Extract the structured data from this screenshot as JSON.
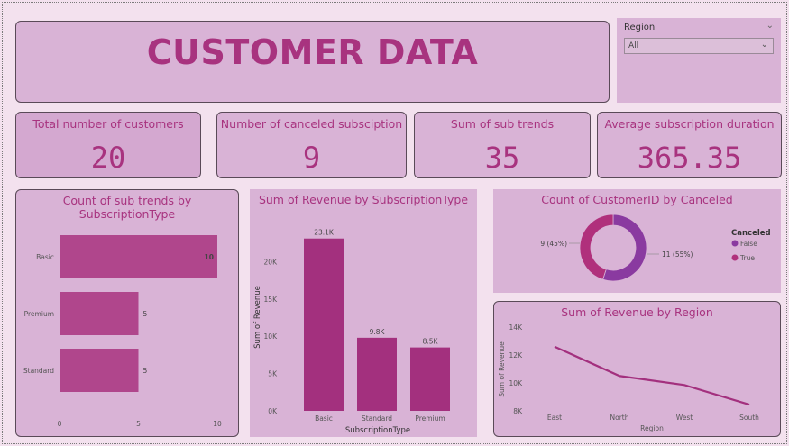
{
  "header": {
    "title": "CUSTOMER DATA"
  },
  "slicer": {
    "label": "Region",
    "value": "All"
  },
  "kpis": [
    {
      "label": "Total number of customers",
      "value": "20"
    },
    {
      "label": "Number of canceled subsciption",
      "value": "9"
    },
    {
      "label": "Sum of sub trends",
      "value": "35"
    },
    {
      "label": "Average subscription duration",
      "value": "365.35"
    }
  ],
  "colors": {
    "accent": "#a8337f",
    "bar_h": "#b0468c",
    "bar_v": "#a3307e",
    "false": "#8a3aa0",
    "true": "#b0307c",
    "line": "#a3307e"
  },
  "chart_data": [
    {
      "type": "bar",
      "orientation": "horizontal",
      "title": "Count of sub trends by SubscriptionType",
      "categories": [
        "Basic",
        "Premium",
        "Standard"
      ],
      "values": [
        10,
        5,
        5
      ],
      "data_labels": [
        "10",
        "5",
        "5"
      ],
      "xticks": [
        "0",
        "5",
        "10"
      ],
      "xlim": [
        0,
        10
      ]
    },
    {
      "type": "bar",
      "title": "Sum of Revenue by SubscriptionType",
      "categories": [
        "Basic",
        "Standard",
        "Premium"
      ],
      "values": [
        23100,
        9800,
        8500
      ],
      "data_labels": [
        "23.1K",
        "9.8K",
        "8.5K"
      ],
      "yticks": [
        "0K",
        "5K",
        "10K",
        "15K",
        "20K"
      ],
      "ylim": [
        0,
        25000
      ],
      "xlabel": "SubscriptionType",
      "ylabel": "Sum of Revenue"
    },
    {
      "type": "pie",
      "donut": true,
      "title": "Count of CustomerID by Canceled",
      "legend_title": "Canceled",
      "slices": [
        {
          "name": "False",
          "value": 11,
          "label": "11 (55%)"
        },
        {
          "name": "True",
          "value": 9,
          "label": "9 (45%)"
        }
      ],
      "legend_position": "right"
    },
    {
      "type": "line",
      "title": "Sum of Revenue by Region",
      "categories": [
        "East",
        "North",
        "West",
        "South"
      ],
      "values": [
        12600,
        10500,
        9850,
        8450
      ],
      "yticks": [
        "8K",
        "10K",
        "12K",
        "14K"
      ],
      "ylim": [
        8000,
        14000
      ],
      "xlabel": "Region",
      "ylabel": "Sum of Revenue"
    }
  ]
}
